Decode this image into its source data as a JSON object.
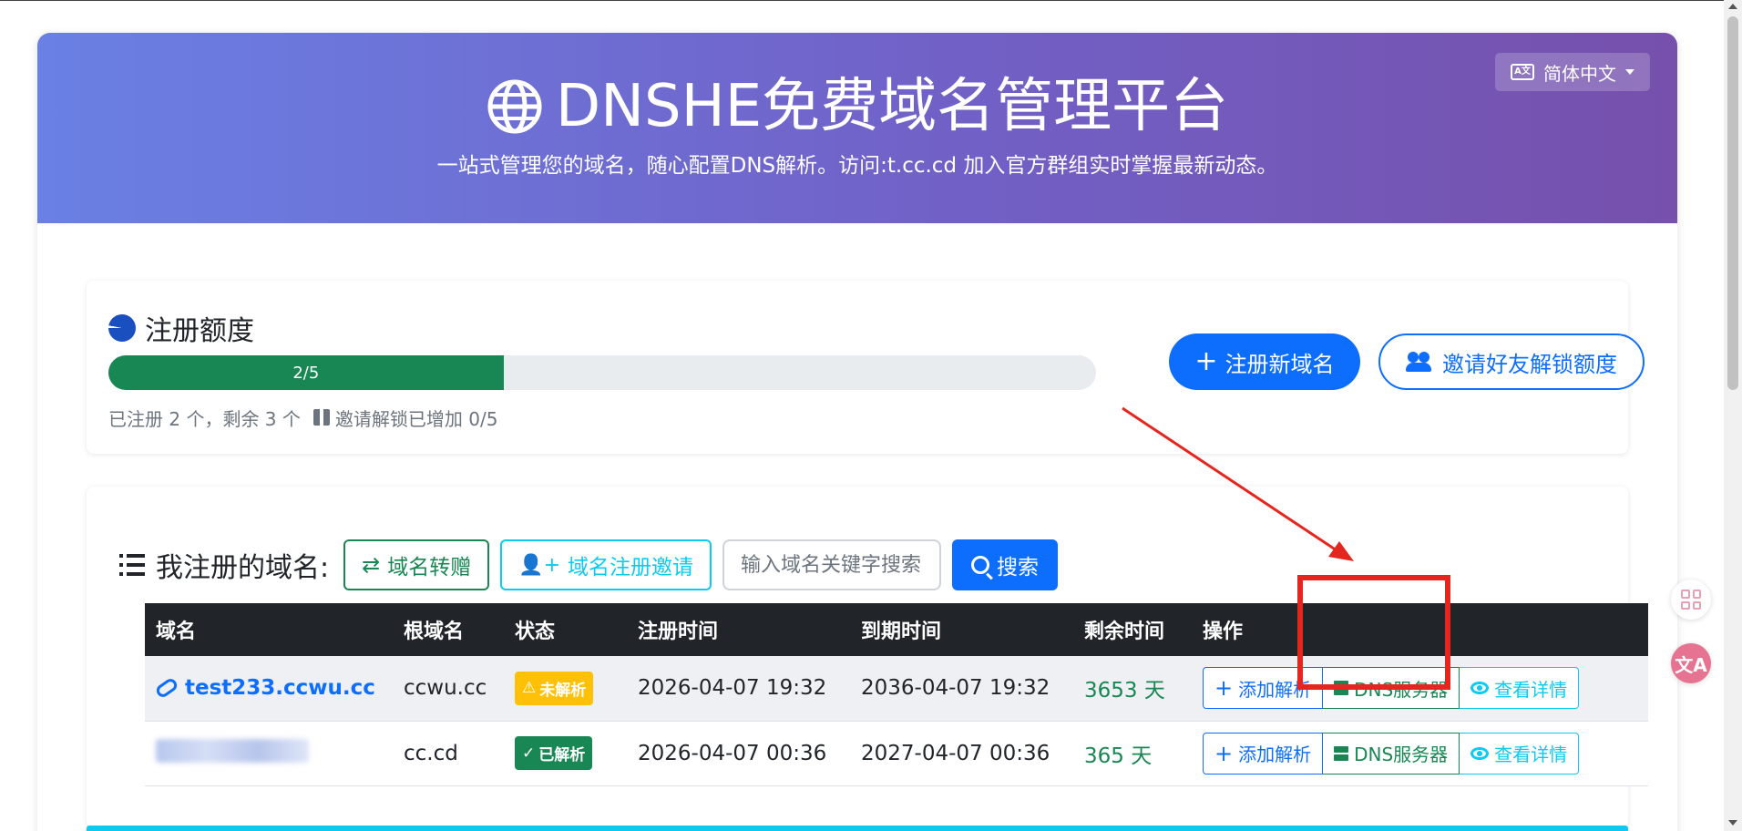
{
  "header": {
    "title": "DNSHE免费域名管理平台",
    "subtitle": "一站式管理您的域名，随心配置DNS解析。访问:t.cc.cd 加入官方群组实时掌握最新动态。",
    "language": "简体中文"
  },
  "quota": {
    "title": "注册额度",
    "progress_label": "2/5",
    "progress_fraction": 0.4,
    "registered_note": "已注册 2 个，剩余 3 个",
    "invite_note": "邀请解锁已增加 0/5",
    "register_button": "注册新域名",
    "invite_button": "邀请好友解锁额度"
  },
  "domains": {
    "title": "我注册的域名:",
    "transfer_button": "域名转赠",
    "invite_button": "域名注册邀请",
    "search_placeholder": "输入域名关键字搜索",
    "search_button": "搜索",
    "columns": [
      "域名",
      "根域名",
      "状态",
      "注册时间",
      "到期时间",
      "剩余时间",
      "操作"
    ],
    "rows": [
      {
        "domain": "test233.ccwu.cc",
        "root": "ccwu.cc",
        "status": "未解析",
        "registered": "2026-04-07 19:32",
        "expires": "2036-04-07 19:32",
        "remaining": "3653 天"
      },
      {
        "domain": "",
        "root": "cc.cd",
        "status": "已解析",
        "registered": "2026-04-07 00:36",
        "expires": "2027-04-07 00:36",
        "remaining": "365 天"
      }
    ],
    "actions": {
      "add_record": "添加解析",
      "dns_server": "DNS服务器",
      "view_detail": "查看详情"
    }
  },
  "colors": {
    "hero_gradient_start": "#6a80e4",
    "hero_gradient_end": "#7650ac",
    "primary": "#0d6efd",
    "success": "#198754",
    "info": "#0dcaf0",
    "warning": "#ffc107",
    "annotation": "#e5261f"
  },
  "icons": {
    "hero": "globe-icon",
    "language": "translate-icon",
    "quota": "pie-chart-icon",
    "gift": "gift-icon",
    "list": "list-icon",
    "transfer": "arrows-exchange-icon",
    "invite": "user-plus-icon",
    "search": "search-icon",
    "link": "link-icon",
    "warning": "warning-triangle-icon",
    "check": "check-icon",
    "plus": "plus-icon",
    "server": "server-icon",
    "eye": "eye-icon"
  }
}
